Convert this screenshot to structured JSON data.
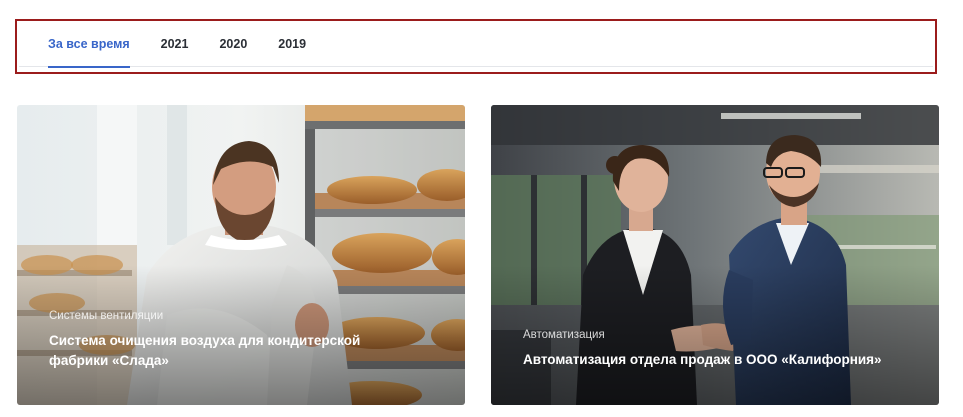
{
  "tabs": [
    {
      "label": "За все время",
      "active": true
    },
    {
      "label": "2021",
      "active": false
    },
    {
      "label": "2020",
      "active": false
    },
    {
      "label": "2019",
      "active": false
    }
  ],
  "cards": [
    {
      "category": "Системы вентиляции",
      "title": "Система очищения воздуха для кондитерской фабрики «Слада»",
      "image": "baker-with-bread-rack-photo"
    },
    {
      "category": "Автоматизация",
      "title": "Автоматизация отдела продаж в ООО «Калифорния»",
      "image": "business-handshake-photo"
    }
  ],
  "colors": {
    "accent": "#3966c9",
    "tab_text": "#2b2f36",
    "highlight_frame": "#9b1c1c"
  }
}
